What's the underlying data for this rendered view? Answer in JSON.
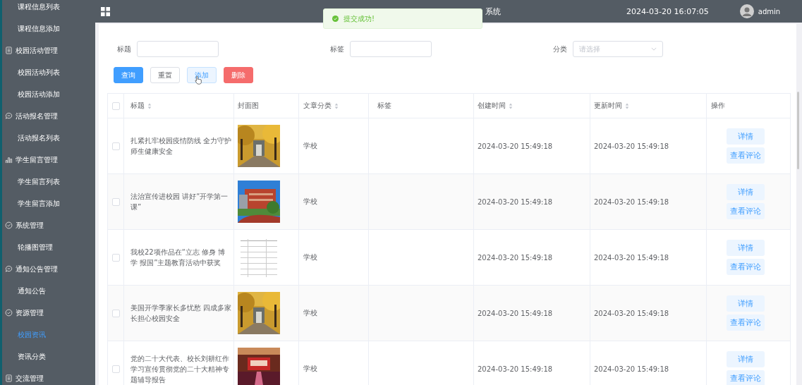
{
  "sidebar": {
    "groups": [
      {
        "children": [
          {
            "label": "课程信息列表",
            "selected": false
          },
          {
            "label": "课程信息添加",
            "selected": false
          }
        ]
      },
      {
        "title": "校园活动管理",
        "kind": "doc",
        "children": [
          {
            "label": "校园活动列表",
            "selected": false
          },
          {
            "label": "校园活动添加",
            "selected": false
          }
        ]
      },
      {
        "title": "活动报名管理",
        "kind": "chat",
        "children": [
          {
            "label": "活动报名列表",
            "selected": false
          }
        ]
      },
      {
        "title": "学生留言管理",
        "kind": "bars",
        "children": [
          {
            "label": "学生留言列表",
            "selected": false
          },
          {
            "label": "学生留言添加",
            "selected": false
          }
        ]
      },
      {
        "title": "系统管理",
        "kind": "check",
        "children": [
          {
            "label": "轮播图管理",
            "selected": false
          }
        ]
      },
      {
        "title": "通知公告管理",
        "kind": "chat",
        "children": [
          {
            "label": "通知公告",
            "selected": false
          }
        ]
      },
      {
        "title": "资源管理",
        "kind": "check",
        "children": [
          {
            "label": "校园资讯",
            "selected": true
          },
          {
            "label": "资讯分类",
            "selected": false
          }
        ]
      },
      {
        "title": "交流管理",
        "kind": "doc"
      }
    ]
  },
  "header": {
    "title_visible": "系统",
    "datetime": "2024-03-20 16:07:05",
    "user": "admin"
  },
  "toast": {
    "message": "提交成功!"
  },
  "search": {
    "fields": [
      {
        "label": "标题",
        "kind": "input"
      },
      {
        "label": "标签",
        "kind": "input"
      },
      {
        "label": "分类",
        "kind": "select",
        "placeholder": "请选择"
      }
    ],
    "buttons": [
      {
        "label": "查询",
        "kind": "primary"
      },
      {
        "label": "重置",
        "kind": "default"
      },
      {
        "label": "添加",
        "kind": "hover"
      },
      {
        "label": "删除",
        "kind": "danger"
      }
    ]
  },
  "table": {
    "all_checked": false,
    "columns": [
      {
        "label": "标题",
        "sortable": true
      },
      {
        "label": "封面图",
        "sortable": false
      },
      {
        "label": "文章分类",
        "sortable": true
      },
      {
        "label": "标签",
        "sortable": false
      },
      {
        "label": "创建时间",
        "sortable": true
      },
      {
        "label": "更新时间",
        "sortable": true
      },
      {
        "label": "操作",
        "sortable": false
      }
    ],
    "rows": [
      {
        "checked": false,
        "title": "扎紧扎牢校园疫情防线 全力守护师生健康安全",
        "category": "学校",
        "created": "2024-03-20 15:49:18",
        "updated": "2024-03-20 15:49:18",
        "actions": [
          "详情",
          "查看评论"
        ]
      },
      {
        "checked": false,
        "title": "法治宣传进校园 讲好“开学第一课”",
        "category": "学校",
        "created": "2024-03-20 15:49:18",
        "updated": "2024-03-20 15:49:18",
        "actions": [
          "详情",
          "查看评论"
        ]
      },
      {
        "checked": false,
        "title": "我校22项作品在“立志 修身 博学 报国”主题教育活动中获奖",
        "category": "学校",
        "created": "2024-03-20 15:49:18",
        "updated": "2024-03-20 15:49:18",
        "actions": [
          "详情",
          "查看评论"
        ]
      },
      {
        "checked": false,
        "title": "美国开学季家长多忧愁 四成多家长担心校园安全",
        "category": "学校",
        "created": "2024-03-20 15:49:18",
        "updated": "2024-03-20 15:49:18",
        "actions": [
          "详情",
          "查看评论"
        ]
      },
      {
        "checked": false,
        "title": "党的二十大代表、校长刘耕红作学习宣传贯彻党的二十大精神专题辅导报告",
        "category": "学校",
        "created": "2024-03-20 15:49:18",
        "updated": "2024-03-20 15:49:18",
        "actions": [
          "详情",
          "查看评论"
        ]
      }
    ]
  }
}
